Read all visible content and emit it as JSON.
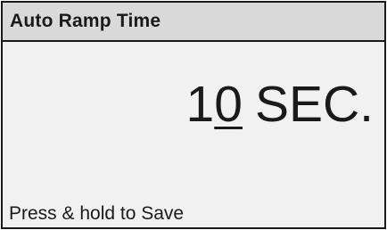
{
  "header": {
    "title": "Auto Ramp Time"
  },
  "setting": {
    "value_prefix": "1",
    "value_selected_digit": "0",
    "unit": "SEC."
  },
  "footer": {
    "hint": "Press & hold to Save"
  }
}
